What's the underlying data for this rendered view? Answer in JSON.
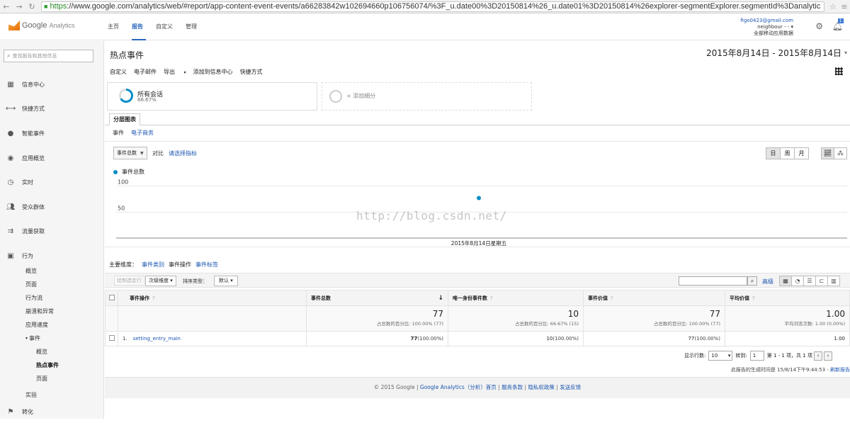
{
  "browser": {
    "url_scheme": "https",
    "url_rest": "://www.google.com/analytics/web/#report/app-content-event-events/a66283842w102694660p106756074/%3F_u.date00%3D20150814%26_u.date01%3D20150814%26explorer-segmentExplorer.segmentId%3Danalytic",
    "icons": [
      "back-arrow",
      "forward-arrow",
      "reload",
      "star",
      "menu"
    ]
  },
  "header": {
    "logo_google": "Google",
    "logo_product": "Analytics",
    "nav": [
      "主页",
      "报告",
      "自定义",
      "管理"
    ],
    "active_nav": "报告",
    "account_email": "figo0423@gmail.com",
    "account_property": "neighbour - -",
    "account_view": "全部移动应用数据",
    "notification_count": "1"
  },
  "sidebar": {
    "search_placeholder": "查找报告和其他信息",
    "items": [
      {
        "label": "信息中心",
        "icon": "grid-icon"
      },
      {
        "label": "快捷方式",
        "icon": "arrows-icon"
      },
      {
        "label": "智能事件",
        "icon": "lightbulb-icon"
      },
      {
        "label": "应用概览",
        "icon": "circle-icon"
      },
      {
        "label": "实时",
        "icon": "clock-icon"
      },
      {
        "label": "受众群体",
        "icon": "people-icon"
      },
      {
        "label": "流量获取",
        "icon": "acquisition-icon"
      },
      {
        "label": "行为",
        "icon": "behavior-icon"
      }
    ],
    "behavior_sub": [
      "概览",
      "页面",
      "行为流",
      "崩溃和异常",
      "应用速度"
    ],
    "events_label": "事件",
    "events_sub": [
      "概览",
      "热点事件",
      "页面"
    ],
    "active_sub": "热点事件",
    "experiments_label": "实验",
    "conversions_label": "转化"
  },
  "main": {
    "title": "热点事件",
    "date_range": "2015年8月14日 - 2015年8月14日",
    "toolbar": [
      "自定义",
      "电子邮件",
      "导出",
      "添加到信息中心",
      "快捷方式"
    ],
    "segment_name": "所有会话",
    "segment_pct": "66.67%",
    "add_segment": "+ 添加细分",
    "tab_label": "分层图表",
    "subtabs": [
      "事件",
      "电子商务"
    ],
    "metric_select": "事件总数",
    "vs_label": "对比",
    "pick_metric": "请选择指标",
    "granularity": [
      "日",
      "周",
      "月"
    ],
    "active_granularity": "日",
    "watermark": "http://blog.csdn.net/"
  },
  "chart_data": {
    "type": "line",
    "series": [
      {
        "name": "事件总数",
        "color": "#058dc7",
        "values": [
          77
        ]
      }
    ],
    "categories": [
      "2015年8月14日星期五"
    ],
    "y_ticks": [
      "100",
      "50"
    ],
    "ylim": [
      0,
      120
    ],
    "grid": true
  },
  "table": {
    "dims_label": "主要维度：",
    "dims": [
      "事件类别",
      "事件操作",
      "事件标签"
    ],
    "active_dim": "事件操作",
    "plot_rows": "绘制选定行",
    "secondary_dim": "次级维度",
    "sort_label": "排序类型：",
    "sort_value": "默认",
    "advanced": "高级",
    "columns": [
      "事件操作",
      "事件总数",
      "唯一身份事件数",
      "事件价值",
      "平均价值"
    ],
    "totals": [
      {
        "value": "77",
        "note": "占总数的百分比: 100.00% (77)"
      },
      {
        "value": "10",
        "note": "占总数的百分比: 66.67% (15)"
      },
      {
        "value": "77",
        "note": "占总数的百分比: 100.00% (77)"
      },
      {
        "value": "1.00",
        "note": "平均浏览次数: 1.00 (0.00%)"
      }
    ],
    "rows": [
      {
        "num": "1.",
        "name": "setting_entry_main",
        "c1": "77",
        "c1p": "(100.00%)",
        "c2": "10",
        "c2p": "(100.00%)",
        "c3": "77",
        "c3p": "(100.00%)",
        "c4": "1.00"
      }
    ],
    "pager_rows_label": "显示行数:",
    "pager_rows": "10",
    "pager_goto_label": "转到:",
    "pager_goto": "1",
    "pager_range": "第 1 - 1 项，共 1 项",
    "gen_time": "此报告的生成时间是 15/8/14下午9:44:53 - ",
    "refresh": "刷新报告"
  },
  "footer": {
    "copyright": "© 2015 Google | ",
    "links": [
      "Google Analytics（分析）首页",
      "服务条款",
      "隐私权政策",
      "发送反馈"
    ]
  }
}
